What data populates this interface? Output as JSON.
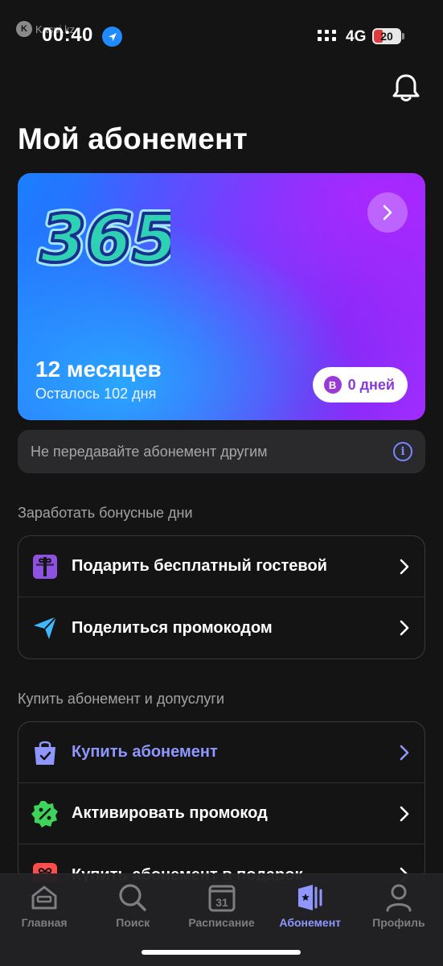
{
  "status_bar": {
    "watermark": "Kaspi.kz",
    "time": "00:40",
    "network": "4G",
    "battery": "20"
  },
  "page_title": "Мой абонемент",
  "card": {
    "logo_text": "365",
    "title": "12 месяцев",
    "subtitle": "Осталось 102 дня",
    "badge_letter": "B",
    "days_label": "0 дней"
  },
  "notice": {
    "text": "Не передавайте абонемент другим",
    "info_glyph": "i"
  },
  "bonus_section": {
    "heading": "Заработать бонусные дни",
    "items": [
      {
        "label": "Подарить бесплатный гостевой",
        "icon": "gift-icon"
      },
      {
        "label": "Поделиться промокодом",
        "icon": "send-icon"
      }
    ]
  },
  "buy_section": {
    "heading": "Купить абонемент и допуслуги",
    "items": [
      {
        "label": "Купить абонемент",
        "icon": "bag-icon"
      },
      {
        "label": "Активировать промокод",
        "icon": "percent-badge-icon"
      },
      {
        "label": "Купить абонемент в подарок",
        "icon": "gift-box-icon"
      }
    ]
  },
  "tabs": [
    {
      "label": "Главная",
      "icon": "home-icon"
    },
    {
      "label": "Поиск",
      "icon": "search-icon"
    },
    {
      "label": "Расписание",
      "icon": "calendar-icon",
      "icon_text": "31"
    },
    {
      "label": "Абонемент",
      "icon": "pass-card-icon",
      "active": true
    },
    {
      "label": "Профиль",
      "icon": "profile-icon"
    }
  ],
  "colors": {
    "background": "#141414",
    "accent": "#8f97ff",
    "card_gradient_start": "#1b7fff",
    "card_gradient_end": "#a22cff"
  }
}
